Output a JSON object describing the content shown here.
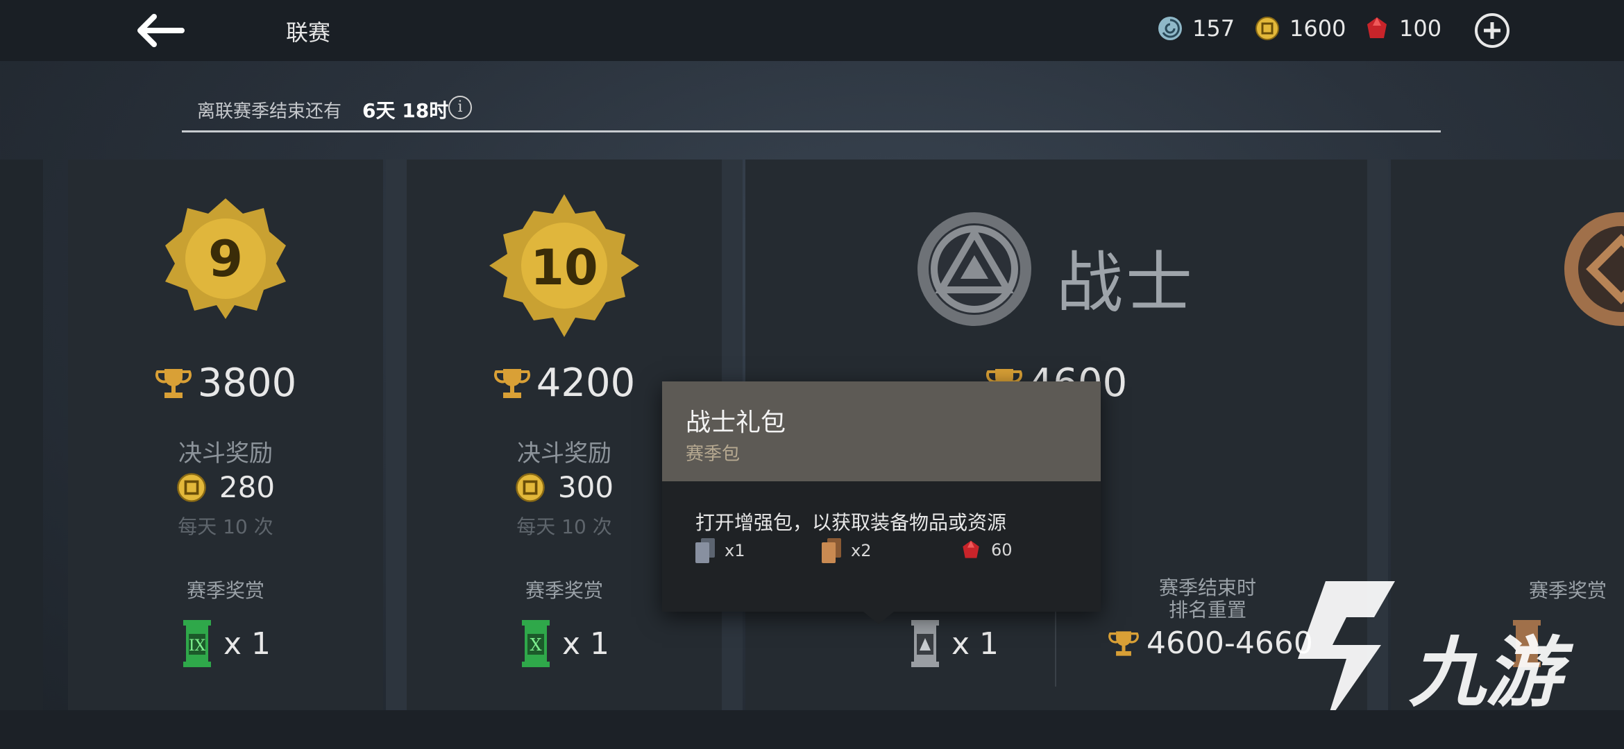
{
  "header": {
    "title": "联赛",
    "currencies": [
      {
        "icon": "spiral-token-icon",
        "value": "157"
      },
      {
        "icon": "gold-coin-icon",
        "value": "1600"
      },
      {
        "icon": "ruby-gem-icon",
        "value": "100"
      }
    ]
  },
  "season_timer": {
    "label": "离联赛季结束还有",
    "value": "6天 18时",
    "info_glyph": "i"
  },
  "tiers": [
    {
      "rank": "9",
      "trophies": "3800",
      "duel_label": "决斗奖励",
      "coins": "280",
      "daily": "每天 10 次",
      "season_label": "赛季奖赏",
      "reward_glyph": "IX",
      "reward_qty": "x 1"
    },
    {
      "rank": "10",
      "trophies": "4200",
      "duel_label": "决斗奖励",
      "coins": "300",
      "daily": "每天 10 次",
      "season_label": "赛季奖赏",
      "reward_glyph": "X",
      "reward_qty": "x 1"
    },
    {
      "rank_name": "战士",
      "trophies": "4600",
      "reward_qty": "x 1",
      "end_label_1": "赛季结束时",
      "end_label_2": "排名重置",
      "end_range": "4600-4660"
    },
    {
      "season_label": "赛季奖赏"
    }
  ],
  "popup": {
    "title": "战士礼包",
    "subtitle": "赛季包",
    "description": "打开增强包，以获取装备物品或资源",
    "items": [
      {
        "icon": "gray-card-icon",
        "qty": "x1"
      },
      {
        "icon": "bronze-card-icon",
        "qty": "x2"
      },
      {
        "icon": "ruby-gem-icon",
        "qty": "60"
      }
    ]
  },
  "watermark": {
    "text": "九游"
  }
}
